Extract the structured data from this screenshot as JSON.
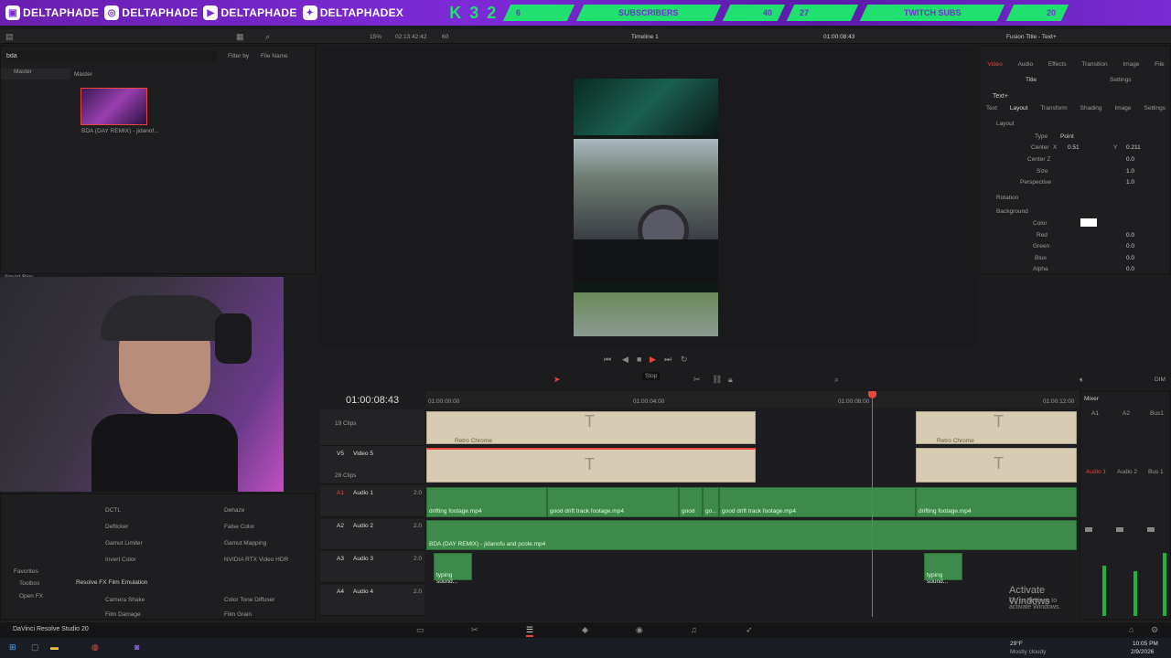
{
  "banner": {
    "socials": [
      "DELTAPHADE",
      "DELTAPHADE",
      "DELTAPHADE",
      "DELTAPHADEX"
    ],
    "logo": "K 3 2",
    "stats": [
      {
        "value": "6",
        "label": "SUBSCRIBERS",
        "goal": "40"
      },
      {
        "value": "27",
        "label": "TWITCH SUBS",
        "goal": "20"
      }
    ]
  },
  "media_pool": {
    "search_value": "bda",
    "filter_label": "Filter by",
    "filter_value": "File Name",
    "bin": "Master",
    "bin_header": "Master",
    "clip_name": "BDA (DAY REMIX) - jidanof...",
    "smart_bins": "Smart Bins"
  },
  "viewer_bar": {
    "zoom": "15%",
    "duration": "02:13:42:42",
    "fps": "60",
    "timeline_name": "Timeline 1",
    "timecode": "01:00:08:43"
  },
  "transport": {
    "tooltip": "Stop"
  },
  "timeline": {
    "timecode": "01:00:08:43",
    "ruler": [
      "01:00:00:00",
      "01:00:04:00",
      "01:00:08:00",
      "01:00:12:00"
    ],
    "tracks": [
      {
        "id": "",
        "name": "",
        "clips": "19 Clips"
      },
      {
        "id": "V5",
        "name": "Video 5",
        "clips": "28 Clips"
      },
      {
        "id": "A1",
        "name": "Audio 1",
        "ch": "2.0"
      },
      {
        "id": "A2",
        "name": "Audio 2",
        "ch": "2.0"
      },
      {
        "id": "A3",
        "name": "Audio 3",
        "ch": "2.0"
      },
      {
        "id": "A4",
        "name": "Audio 4",
        "ch": "2.0"
      }
    ],
    "clip_labels": {
      "retro1": "Retro Chrome",
      "retro2": "Retro Chrome",
      "a1_1": "drifting footage.mp4",
      "a1_2": "good drift track footage.mp4",
      "a1_3": "good",
      "a1_4": "go...",
      "a1_5": "good drift track footage.mp4",
      "a1_6": "drifting footage.mp4",
      "a2_1": "BDA (DAY REMIX) - jidanofu and pcole.mp4",
      "a3_1": "typing sound...",
      "a3_2": "typing sound..."
    },
    "title_glyph": "T"
  },
  "effects": {
    "items": [
      [
        "DCTL",
        "Dehaze"
      ],
      [
        "Deflicker",
        "False Color"
      ],
      [
        "Gamut Limiter",
        "Gamut Mapping"
      ],
      [
        "Invert Color",
        "NVIDIA RTX Video HDR"
      ]
    ],
    "favorites": "Favorites",
    "toolbox": "Toolbox",
    "openfx": "Open FX",
    "section": "Resolve FX Film Emulation",
    "items2": [
      [
        "Camera Shake",
        "Color Tone Diffuser"
      ],
      [
        "Film Damage",
        "Film Grain"
      ]
    ]
  },
  "inspector": {
    "header": "Fusion Title - Text+",
    "tabs": [
      "Video",
      "Audio",
      "Effects",
      "Transition",
      "Image",
      "File"
    ],
    "subtabs": [
      "Title",
      "Settings"
    ],
    "node": "Text+",
    "ftabs": [
      "Text",
      "Layout",
      "Transform",
      "Shading",
      "Image",
      "Settings"
    ],
    "section_layout": "Layout",
    "type_label": "Type",
    "type_value": "Point",
    "center_label": "Center",
    "center_x_label": "X",
    "center_x": "0.51",
    "center_y_label": "Y",
    "center_y": "0.211",
    "centerz_label": "Center Z",
    "centerz": "0.0",
    "size_label": "Size",
    "size": "1.0",
    "persp_label": "Perspective",
    "persp": "1.0",
    "rotation": "Rotation",
    "background": "Background",
    "color_label": "Color",
    "red_label": "Red",
    "red": "0.0",
    "green_label": "Green",
    "green": "0.0",
    "blue_label": "Blue",
    "blue": "0.0",
    "alpha_label": "Alpha",
    "alpha": "0.0"
  },
  "mixer": {
    "title": "Mixer",
    "channels": [
      "A1",
      "A2",
      "Bus1"
    ],
    "channel_names": [
      "Audio 1",
      "Audio 2",
      "Bus 1"
    ],
    "dim": "DIM"
  },
  "watermark": {
    "title": "Activate Windows",
    "sub": "Go to Settings to activate Windows."
  },
  "app": {
    "name": "DaVinci Resolve Studio 20"
  },
  "taskbar": {
    "weather_temp": "29°F",
    "weather_desc": "Mostly cloudy",
    "time": "10:05 PM",
    "date": "2/9/2026"
  },
  "colors": {
    "accent": "#e8453c",
    "green": "#3d8a4a",
    "tan": "#d7ccb3",
    "banner": "#7b2bd4",
    "stat": "#20e070"
  }
}
